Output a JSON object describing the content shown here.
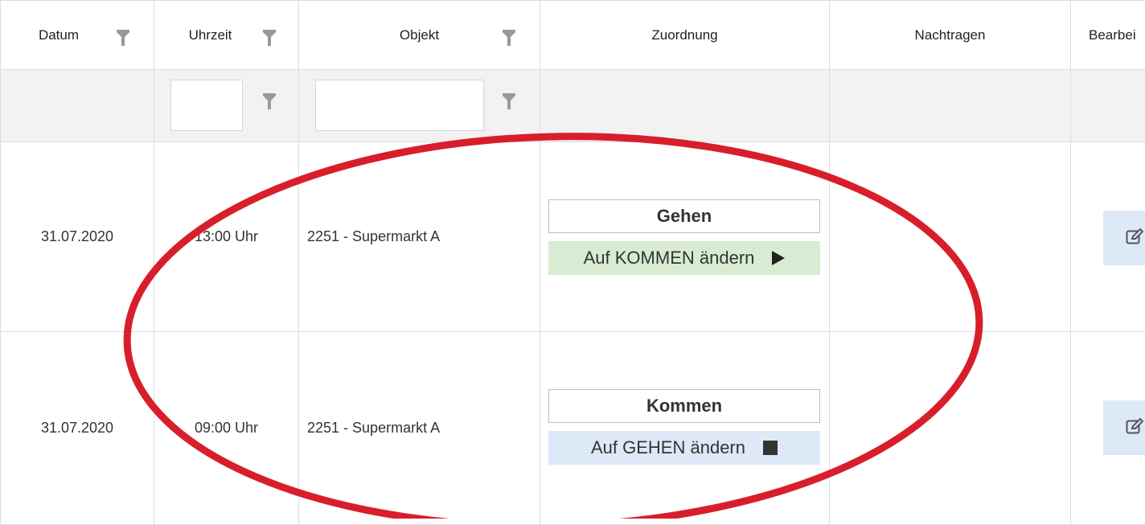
{
  "columns": [
    {
      "label": "Datum",
      "filterable": true
    },
    {
      "label": "Uhrzeit",
      "filterable": true
    },
    {
      "label": "Objekt",
      "filterable": true
    },
    {
      "label": "Zuordnung",
      "filterable": false
    },
    {
      "label": "Nachtragen",
      "filterable": false
    },
    {
      "label": "Bearbei",
      "filterable": false
    }
  ],
  "filters": {
    "uhrzeit_value": "",
    "objekt_value": ""
  },
  "rows": [
    {
      "datum": "31.07.2020",
      "uhrzeit": "13:00 Uhr",
      "objekt": "2251 - Supermarkt A",
      "zuordnung": "Gehen",
      "change_label": "Auf KOMMEN ändern",
      "change_icon": "play-icon",
      "change_color": "#d8ecd3"
    },
    {
      "datum": "31.07.2020",
      "uhrzeit": "09:00 Uhr",
      "objekt": "2251 - Supermarkt A",
      "zuordnung": "Kommen",
      "change_label": "Auf GEHEN ändern",
      "change_icon": "stop-icon",
      "change_color": "#dde9f7"
    }
  ],
  "colors": {
    "annotation_ellipse": "#d81e2a",
    "edit_button_bg": "#dde9f7",
    "filter_row_bg": "#f2f2f2",
    "grid_line": "#dddddd"
  }
}
